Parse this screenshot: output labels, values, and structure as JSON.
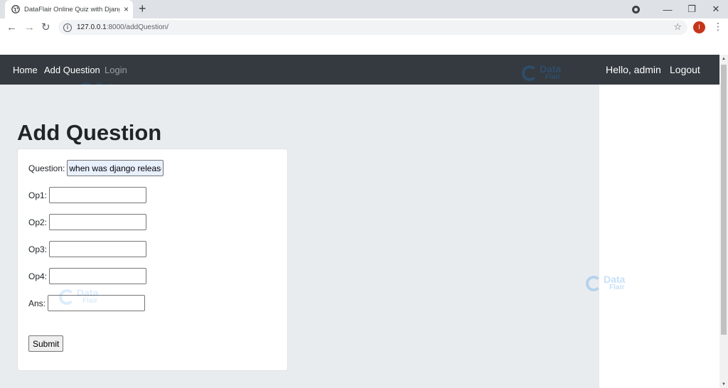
{
  "browser": {
    "tab_title": "DataFlair Online Quiz with Django",
    "tab_close": "×",
    "new_tab": "+",
    "url_host": "127.0.0.1",
    "url_path": ":8000/addQuestion/",
    "avatar_letter": "I",
    "star": "☆",
    "back": "←",
    "forward": "→",
    "reload": "↻",
    "menu": "⋮",
    "minimize": "—",
    "restore": "❐",
    "close": "✕"
  },
  "navbar": {
    "home": "Home",
    "add_question": "Add Question",
    "login": "Login",
    "greeting": "Hello, admin",
    "logout": "Logout"
  },
  "page": {
    "title": "Add Question"
  },
  "form": {
    "question_label": "Question:",
    "question_value": "when was django released",
    "op1_label": "Op1:",
    "op2_label": "Op2:",
    "op3_label": "Op3:",
    "op4_label": "Op4:",
    "ans_label": "Ans:",
    "op1_value": "",
    "op2_value": "",
    "op3_value": "",
    "op4_value": "",
    "ans_value": "",
    "submit_label": "Submit"
  },
  "watermark": {
    "line1": "Data",
    "line2": "Flair"
  },
  "colors": {
    "navbar_bg": "#343a40",
    "content_bg": "#e9ecef",
    "brand_watermark": "#1e88e5"
  }
}
